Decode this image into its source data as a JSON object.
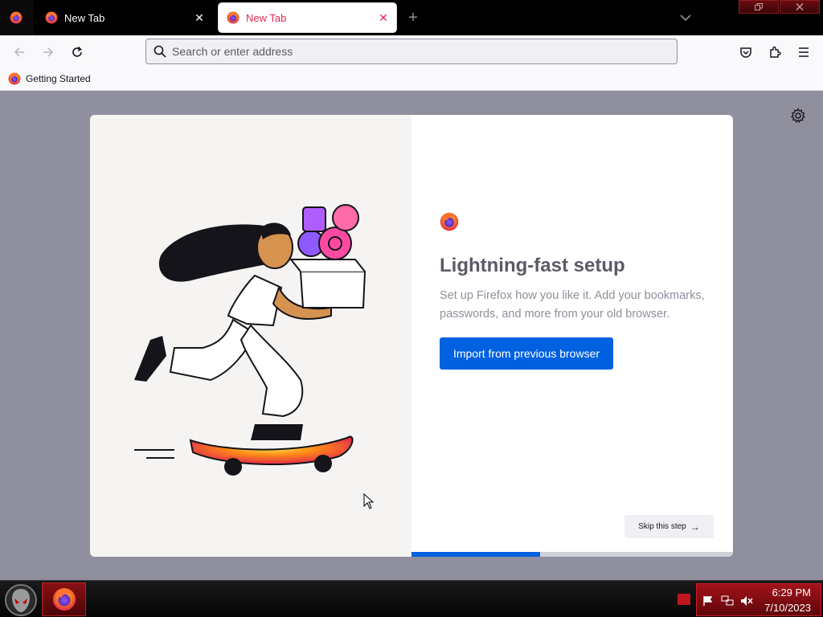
{
  "tabs": {
    "inactive": {
      "label": "New Tab",
      "close": "✕"
    },
    "active": {
      "label": "New Tab",
      "close": "✕"
    },
    "new_tab": "+"
  },
  "urlbar": {
    "placeholder": "Search or enter address"
  },
  "bookmarks": [
    {
      "label": "Getting Started"
    }
  ],
  "card": {
    "title": "Lightning-fast setup",
    "subtitle": "Set up Firefox how you like it. Add your bookmarks, passwords, and more from your old browser.",
    "import_label": "Import from previous browser",
    "skip_label": "Skip this step",
    "skip_arrow": "→",
    "progress": 0.4
  },
  "taskbar": {
    "time": "6:29 PM",
    "date": "7/10/2023"
  },
  "colors": {
    "accent": "#0061e0",
    "active_tab_text": "#e22850",
    "taskbar_red": "#a3121a"
  },
  "icons": [
    "firefox-logo-icon",
    "close-icon",
    "plus-icon",
    "chevron-down-icon",
    "back-arrow-icon",
    "forward-arrow-icon",
    "reload-icon",
    "search-icon",
    "pocket-icon",
    "extensions-icon",
    "hamburger-menu-icon",
    "gear-icon",
    "arrow-right-icon",
    "flag-icon",
    "network-icon",
    "speaker-muted-icon"
  ]
}
